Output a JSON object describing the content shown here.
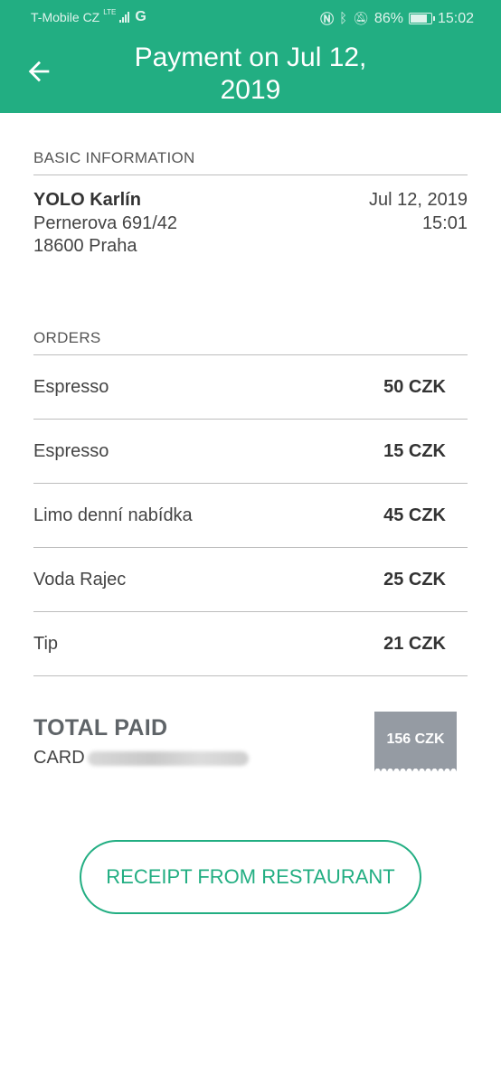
{
  "status_bar": {
    "carrier": "T-Mobile CZ",
    "network": "LTE",
    "data_icon": "G",
    "battery": "86%",
    "time": "15:02",
    "battery_level": 0.86
  },
  "app_bar": {
    "title": "Payment on Jul 12, 2019",
    "back_icon": "arrow-left-icon"
  },
  "basic_info": {
    "header": "BASIC INFORMATION",
    "venue_name": "YOLO Karlín",
    "address_line1": "Pernerova 691/42",
    "address_line2": "18600 Praha",
    "date": "Jul 12, 2019",
    "time": "15:01"
  },
  "orders": {
    "header": "ORDERS",
    "items": [
      {
        "name": "Espresso",
        "price": "50 CZK"
      },
      {
        "name": "Espresso",
        "price": "15 CZK"
      },
      {
        "name": "Limo denní nabídka",
        "price": "45 CZK"
      },
      {
        "name": "Voda Rajec",
        "price": "25 CZK"
      },
      {
        "name": "Tip",
        "price": "21 CZK"
      }
    ]
  },
  "total": {
    "label": "TOTAL PAID",
    "method": "CARD",
    "amount": "156 CZK"
  },
  "receipt_button": {
    "label": "RECEIPT FROM RESTAURANT"
  },
  "colors": {
    "accent": "#22ae82",
    "badge": "#959ba3"
  }
}
